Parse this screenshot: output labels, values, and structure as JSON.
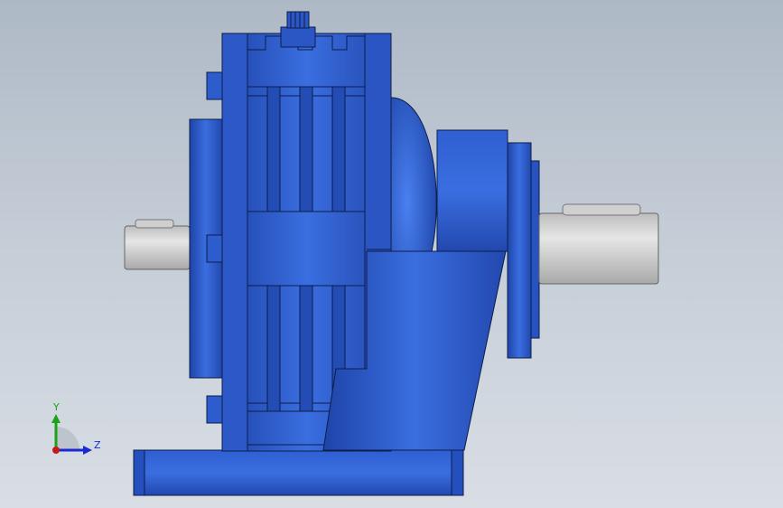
{
  "viewport": {
    "background_top": "#aeb9c6",
    "background_bottom": "#d9dee5",
    "model_color": "#2a57c4",
    "model_shadow": "#1a3a90",
    "shaft_color": "#d3d3d3"
  },
  "triad": {
    "y_label": "Y",
    "z_label": "Z",
    "y_color": "#1aa21a",
    "z_color": "#1a2ad0",
    "x_color": "#c41a1a"
  }
}
